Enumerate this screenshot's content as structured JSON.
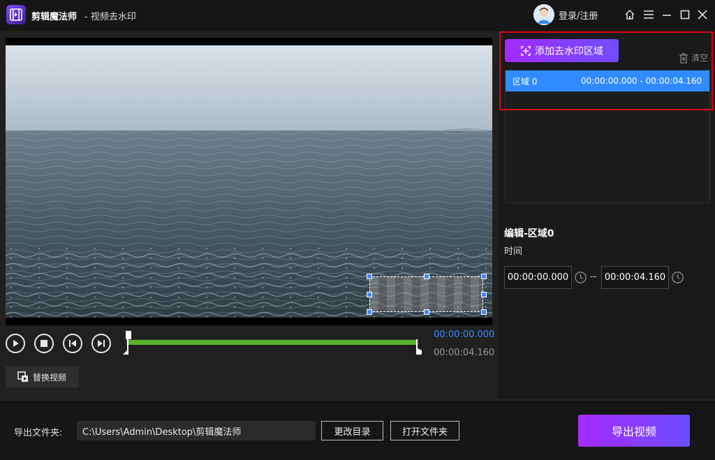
{
  "app": {
    "name": "剪辑魔法师",
    "subtitle": "- 视频去水印",
    "login_label": "登录/注册"
  },
  "player": {
    "current_time": "00:00:00.000",
    "end_time": "00:00:04.160",
    "replace_label": "替换视频",
    "range_selected_fraction": 1.0
  },
  "regions": {
    "add_label": "添加去水印区域",
    "clear_label": "清空",
    "items": [
      {
        "name": "区域 0",
        "range": "00:00:00.000 - 00:00:04.160"
      }
    ]
  },
  "edit": {
    "title": "编辑-区域0",
    "time_label": "时间",
    "start": "00:00:00.000",
    "end": "00:00:04.160",
    "separator": "--"
  },
  "export": {
    "folder_label": "导出文件夹:",
    "path": "C:\\Users\\Admin\\Desktop\\剪辑魔法师",
    "change_dir_label": "更改目录",
    "open_folder_label": "打开文件夹",
    "export_label": "导出视频"
  },
  "colors": {
    "accent_purple": "#a02bff",
    "accent_blue": "#2f8bff",
    "progress_green": "#58b12a",
    "highlight_red": "#e0001b"
  },
  "icons": [
    "app-logo-icon",
    "user-avatar-icon",
    "home-icon",
    "menu-icon",
    "minimize-icon",
    "maximize-icon",
    "close-icon",
    "play-icon",
    "stop-icon",
    "prev-frame-icon",
    "next-frame-icon",
    "replace-video-icon",
    "add-region-icon",
    "trash-icon",
    "clock-icon"
  ]
}
